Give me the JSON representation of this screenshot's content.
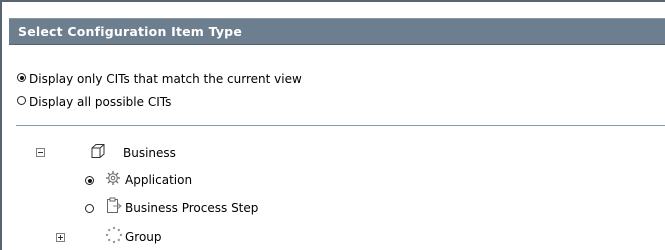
{
  "panel": {
    "title": "Select Configuration Item Type"
  },
  "view_options": [
    {
      "label": "Display only CITs that match the current view",
      "selected": true
    },
    {
      "label": "Display all possible CITs",
      "selected": false
    }
  ],
  "tree": {
    "root": {
      "label": "Business",
      "icon": "cube-icon",
      "expanded": true
    },
    "children": [
      {
        "label": "Application",
        "icon": "gear-icon",
        "selected": true
      },
      {
        "label": "Business Process Step",
        "icon": "process-step-icon",
        "selected": false
      },
      {
        "label": "Group",
        "icon": "group-icon",
        "expandable": true,
        "expanded": false
      }
    ]
  }
}
